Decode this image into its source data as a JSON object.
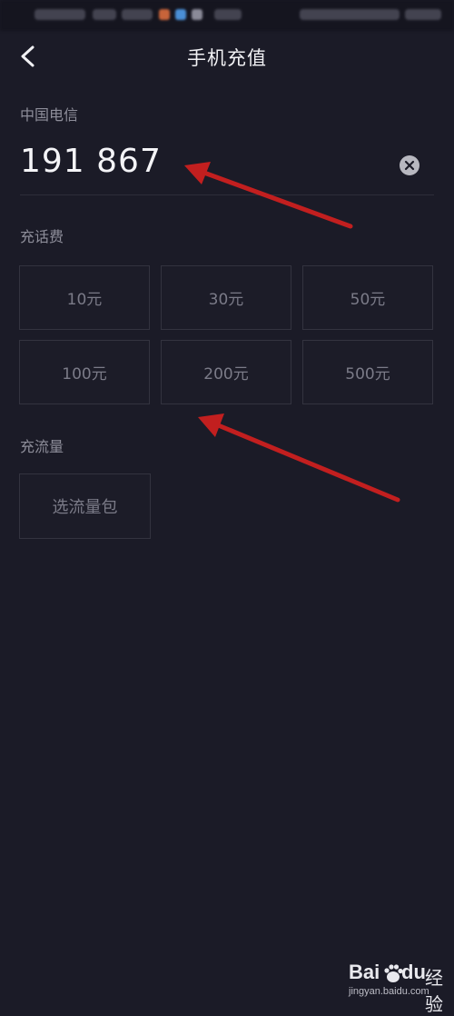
{
  "header": {
    "title": "手机充值"
  },
  "recharge": {
    "carrier": "中国电信",
    "phone_number": "191 867",
    "bill_label": "充话费",
    "amounts": [
      "10元",
      "30元",
      "50元",
      "100元",
      "200元",
      "500元"
    ],
    "data_label": "充流量",
    "data_button": "选流量包"
  },
  "watermark": {
    "brand_left": "Bai",
    "brand_right": "du",
    "product": "经验",
    "url": "jingyan.baidu.com"
  },
  "colors": {
    "background": "#1b1b27",
    "annotation_arrow": "#c21f1f"
  },
  "icons": {
    "back": "chevron-left-icon",
    "clear": "clear-circle-icon"
  }
}
